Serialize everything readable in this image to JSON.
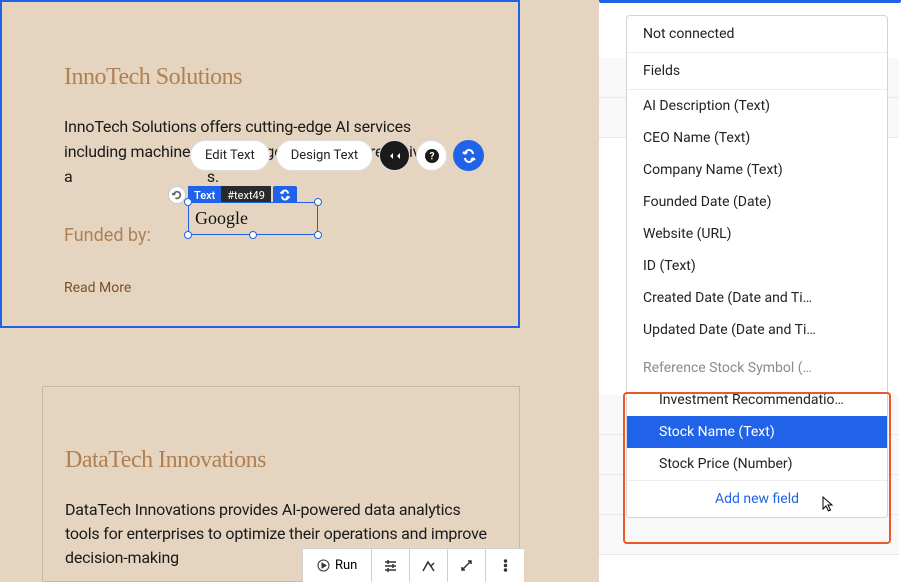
{
  "card1": {
    "title": "InnoTech Solutions",
    "desc_before": "InnoTech Solutions offers cutting-edge AI services including machine learning algorithms and predictive a",
    "desc_after": "s.",
    "funded_label": "Funded by:",
    "funded_value": "Google",
    "read_more": "Read More"
  },
  "card2": {
    "title": "DataTech Innovations",
    "desc": "DataTech Innovations provides AI-powered data analytics tools for enterprises to optimize their operations and improve decision-making"
  },
  "selection": {
    "type_label": "Text",
    "id": "#text49"
  },
  "float_toolbar": {
    "edit": "Edit Text",
    "design": "Design Text"
  },
  "dropdown": {
    "not_connected": "Not connected",
    "fields_header": "Fields",
    "items": [
      "AI Description (Text)",
      "CEO Name (Text)",
      "Company Name (Text)",
      "Founded Date (Date)",
      "Website (URL)",
      "ID (Text)",
      "Created Date (Date and Ti…",
      "Updated Date (Date and Ti…"
    ],
    "ref_header": "Reference Stock Symbol (…",
    "ref_items": [
      "Investment Recommendatio…",
      "Stock Name (Text)",
      "Stock Price (Number)"
    ],
    "add_new": "Add new field"
  },
  "bottom": {
    "run": "Run"
  }
}
